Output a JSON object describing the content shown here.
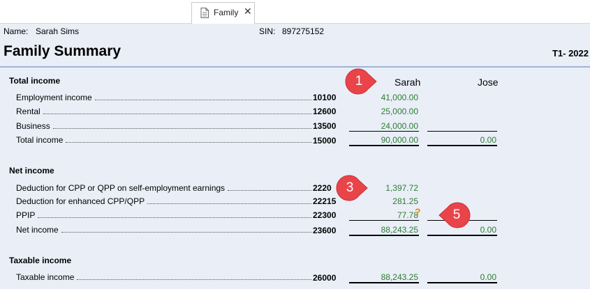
{
  "tabs": [
    {
      "label": "Family",
      "icon": "document-icon",
      "close": "✕"
    }
  ],
  "header": {
    "name_label": "Name:",
    "name_value": "Sarah Sims",
    "sin_label": "SIN:",
    "sin_value": "897275152",
    "title": "Family Summary",
    "form_code": "T1- 2022"
  },
  "columns": [
    "Sarah",
    "Jose"
  ],
  "sections": [
    {
      "heading": "Total income",
      "rows": [
        {
          "label": "Employment income",
          "line": "10100",
          "sarah": "41,000.00",
          "jose": ""
        },
        {
          "label": "Rental",
          "line": "12600",
          "sarah": "25,000.00",
          "jose": ""
        },
        {
          "label": "Business",
          "line": "13500",
          "sarah": "24,000.00",
          "jose": ""
        },
        {
          "label": "Total income",
          "line": "15000",
          "sarah": "90,000.00",
          "jose": "0.00"
        }
      ]
    },
    {
      "heading": "Net income",
      "rows": [
        {
          "label": "Deduction for CPP or QPP on self-employment earnings",
          "line": "2220",
          "sarah": "1,397.72",
          "jose": ""
        },
        {
          "label": "Deduction for enhanced CPP/QPP",
          "line": "22215",
          "sarah": "281.25",
          "jose": ""
        },
        {
          "label": "PPIP",
          "line": "22300",
          "sarah": "77.78",
          "jose": ""
        },
        {
          "label": "Net income",
          "line": "23600",
          "sarah": "88,243.25",
          "jose": "0.00"
        }
      ]
    },
    {
      "heading": "Taxable income",
      "rows": [
        {
          "label": "Taxable income",
          "line": "26000",
          "sarah": "88,243.25",
          "jose": "0.00"
        }
      ]
    }
  ],
  "callouts": [
    "1",
    "3",
    "5"
  ],
  "question_mark": "?",
  "colors": {
    "amount": "#2e7d32",
    "callout": "#e8444a",
    "background": "#e9eef7",
    "warning": "#f08a00"
  }
}
